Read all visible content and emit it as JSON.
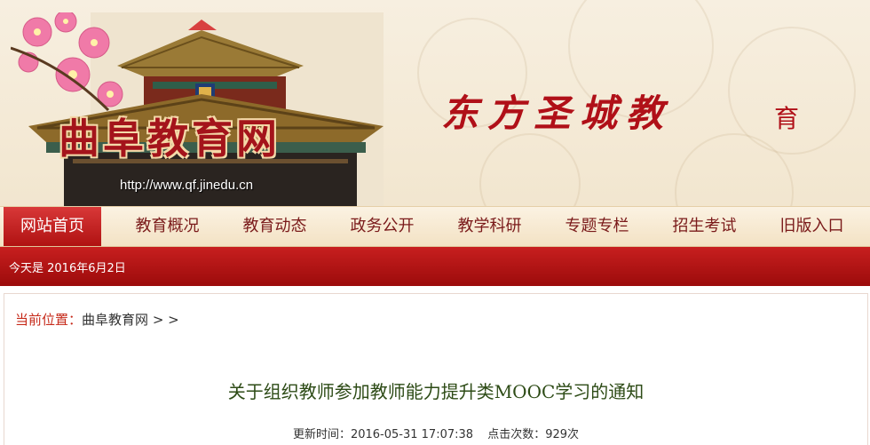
{
  "banner": {
    "site_title": "曲阜教育网",
    "site_url": "http://www.qf.jinedu.cn",
    "slogan": "东方圣城教",
    "slogan_tail": "育"
  },
  "nav": {
    "items": [
      {
        "label": "网站首页",
        "active": true
      },
      {
        "label": "教育概况"
      },
      {
        "label": "教育动态"
      },
      {
        "label": "政务公开"
      },
      {
        "label": "教学科研"
      },
      {
        "label": "专题专栏"
      },
      {
        "label": "招生考试"
      },
      {
        "label": "旧版入口"
      }
    ]
  },
  "datebar": {
    "text": "今天是 2016年6月2日"
  },
  "breadcrumb": {
    "label": "当前位置：",
    "home": "曲阜教育网",
    "sep": "> >"
  },
  "article": {
    "title": "关于组织教师参加教师能力提升类MOOC学习的通知",
    "updated": "更新时间：2016-05-31 17:07:38",
    "clicks": "点击次数：929次"
  },
  "colors": {
    "nav_active": "#c01a1a",
    "datebar": "#b01414",
    "title": "#2d4b16"
  }
}
